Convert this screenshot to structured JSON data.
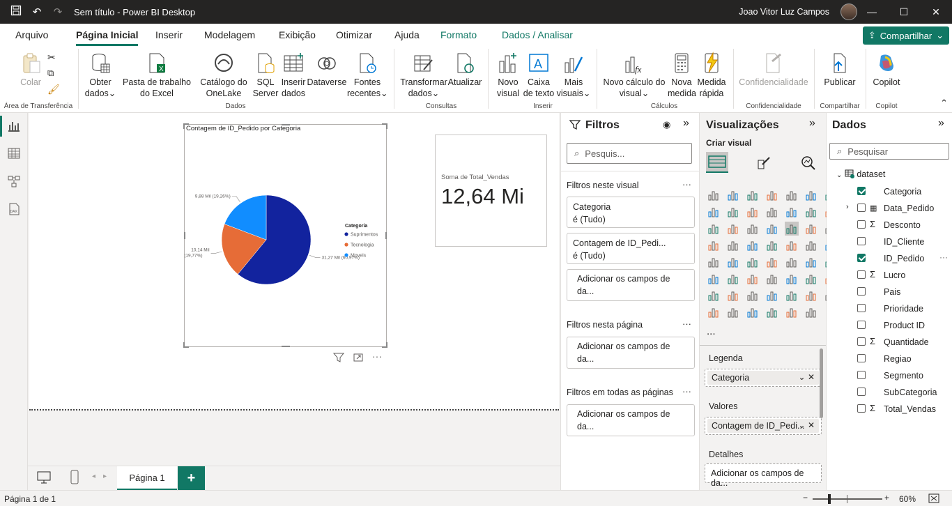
{
  "app": {
    "window_title": "Sem título - Power BI Desktop",
    "user_name": "Joao Vitor Luz Campos",
    "share_label": "Compartilhar"
  },
  "tabs": [
    {
      "label": "Arquivo"
    },
    {
      "label": "Página Inicial",
      "active": true
    },
    {
      "label": "Inserir"
    },
    {
      "label": "Modelagem"
    },
    {
      "label": "Exibição"
    },
    {
      "label": "Otimizar"
    },
    {
      "label": "Ajuda"
    },
    {
      "label": "Formato",
      "contextual": true
    },
    {
      "label": "Dados / Analisar",
      "contextual": true
    }
  ],
  "ribbon": {
    "buttons": {
      "colar": "Colar",
      "obter_dados": "Obter dados",
      "pasta_excel": "Pasta de trabalho do Excel",
      "catalogo": "Catálogo do OneLake",
      "sql": "SQL Server",
      "inserir_dados": "Inserir dados",
      "dataverse": "Dataverse",
      "fontes": "Fontes recentes",
      "transformar": "Transformar dados",
      "atualizar": "Atualizar",
      "novo_visual": "Novo visual",
      "caixa_texto": "Caixa de texto",
      "mais_visuais": "Mais visuais",
      "novo_calculo": "Novo cálculo do visual",
      "nova_medida": "Nova medida",
      "medida_rapida": "Medida rápida",
      "confidencialidade": "Confidencialidade",
      "publicar": "Publicar",
      "copilot": "Copilot"
    },
    "groups": {
      "area": "Área de Transferência",
      "dados": "Dados",
      "consultas": "Consultas",
      "inserir": "Inserir",
      "calculos": "Cálculos",
      "confidencialidade": "Confidencialidade",
      "compartilhar": "Compartilhar",
      "copilot": "Copilot"
    }
  },
  "report": {
    "pie_visual": {
      "title": "Contagem de ID_Pedido por Categoria",
      "legend_title": "Categoria"
    },
    "card_visual": {
      "label": "Soma de Total_Vendas",
      "value": "12,64 Mi"
    },
    "page_tab": "Página 1",
    "add_page": "+"
  },
  "chart_data": {
    "type": "pie",
    "title": "Contagem de ID_Pedido por Categoria",
    "legend_title": "Categoria",
    "legend_position": "right",
    "slices": [
      {
        "name": "Suprimentos",
        "value": 31.27,
        "label": "31,27 Mil (60,97%)",
        "color": "#12239e"
      },
      {
        "name": "Tecnologia",
        "value": 10.14,
        "label": "10,14 Mil (19,77%)",
        "color": "#e66c37"
      },
      {
        "name": "Moveis",
        "value": 9.88,
        "label": "9,88 Mil (19,26%)",
        "color": "#118dff"
      }
    ]
  },
  "filters": {
    "title": "Filtros",
    "search_placeholder": "Pesquis...",
    "section_visual": "Filtros neste visual",
    "filter1_field": "Categoria",
    "filter1_state": "é (Tudo)",
    "filter2_field": "Contagem de ID_Pedi...",
    "filter2_state": "é (Tudo)",
    "add_fields": "Adicionar os campos de da...",
    "section_page": "Filtros nesta página",
    "section_all": "Filtros em todas as páginas"
  },
  "visualizations": {
    "title": "Visualizações",
    "subtitle": "Criar visual",
    "more": "...",
    "legend_caption": "Legenda",
    "legend_field": "Categoria",
    "values_caption": "Valores",
    "values_field": "Contagem de ID_Pedi...",
    "details_caption": "Detalhes",
    "details_add": "Adicionar os campos de da..."
  },
  "data_pane": {
    "title": "Dados",
    "search_placeholder": "Pesquisar",
    "table_name": "dataset",
    "fields": [
      {
        "name": "Categoria",
        "checked": true,
        "sigma": false
      },
      {
        "name": "Data_Pedido",
        "checked": false,
        "sigma": false,
        "expandable": true
      },
      {
        "name": "Desconto",
        "checked": false,
        "sigma": true
      },
      {
        "name": "ID_Cliente",
        "checked": false,
        "sigma": false
      },
      {
        "name": "ID_Pedido",
        "checked": true,
        "sigma": false
      },
      {
        "name": "Lucro",
        "checked": false,
        "sigma": true
      },
      {
        "name": "Pais",
        "checked": false,
        "sigma": false
      },
      {
        "name": "Prioridade",
        "checked": false,
        "sigma": false
      },
      {
        "name": "Product ID",
        "checked": false,
        "sigma": false
      },
      {
        "name": "Quantidade",
        "checked": false,
        "sigma": true
      },
      {
        "name": "Regiao",
        "checked": false,
        "sigma": false
      },
      {
        "name": "Segmento",
        "checked": false,
        "sigma": false
      },
      {
        "name": "SubCategoria",
        "checked": false,
        "sigma": false
      },
      {
        "name": "Total_Vendas",
        "checked": false,
        "sigma": true
      }
    ]
  },
  "status": {
    "page_info": "Página 1 de 1",
    "zoom": "60%"
  },
  "colors": {
    "accent": "#117865",
    "titlebar": "#252423"
  }
}
